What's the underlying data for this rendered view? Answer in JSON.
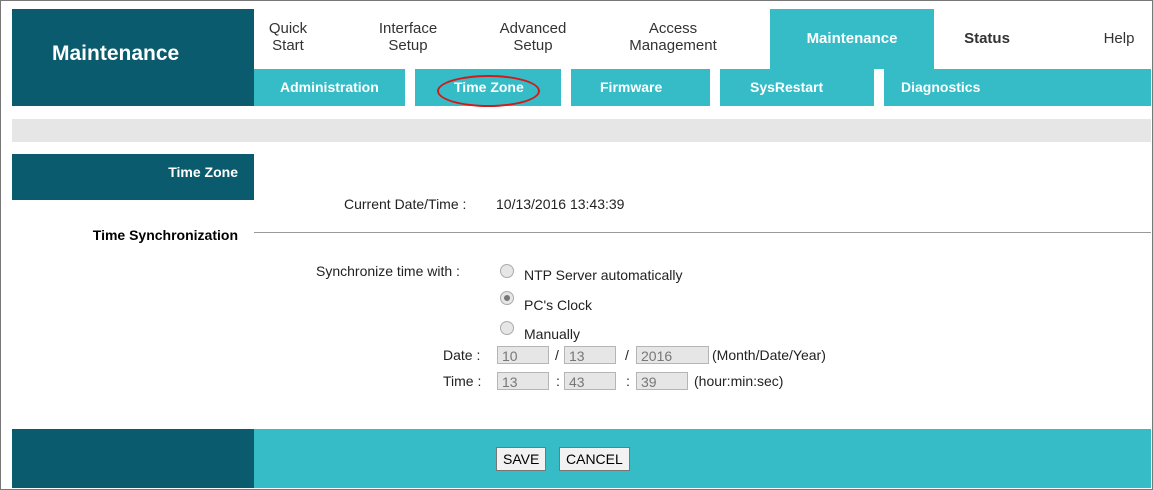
{
  "logo": {
    "title": "Maintenance"
  },
  "tabs": [
    {
      "line1": "Quick",
      "line2": "Start"
    },
    {
      "line1": "Interface",
      "line2": "Setup"
    },
    {
      "line1": "Advanced",
      "line2": "Setup"
    },
    {
      "line1": "Access",
      "line2": "Management"
    },
    {
      "line1": "Maintenance",
      "line2": ""
    },
    {
      "line1": "Status",
      "line2": ""
    },
    {
      "line1": "Help",
      "line2": ""
    }
  ],
  "subnav": [
    "Administration",
    "Time Zone",
    "Firmware",
    "SysRestart",
    "Diagnostics"
  ],
  "sidebar": {
    "section1": "Time Zone",
    "section2": "Time Synchronization"
  },
  "current": {
    "label": "Current Date/Time :",
    "value": "10/13/2016 13:43:39"
  },
  "sync": {
    "label": "Synchronize time with :",
    "options": [
      "NTP Server automatically",
      "PC's Clock",
      "Manually"
    ],
    "selected": "PC's Clock"
  },
  "date": {
    "label": "Date :",
    "month": "10",
    "day": "13",
    "year": "2016",
    "sep1": "/",
    "sep2": "/",
    "hint": "(Month/Date/Year)"
  },
  "time": {
    "label": "Time :",
    "hour": "13",
    "min": "43",
    "sec": "39",
    "sep1": ":",
    "sep2": ":",
    "hint": "(hour:min:sec)"
  },
  "buttons": {
    "save": "SAVE",
    "cancel": "CANCEL"
  },
  "colors": {
    "dark": "#0b5b6e",
    "accent": "#36bcc7",
    "highlight_circle": "#d21a1a"
  }
}
